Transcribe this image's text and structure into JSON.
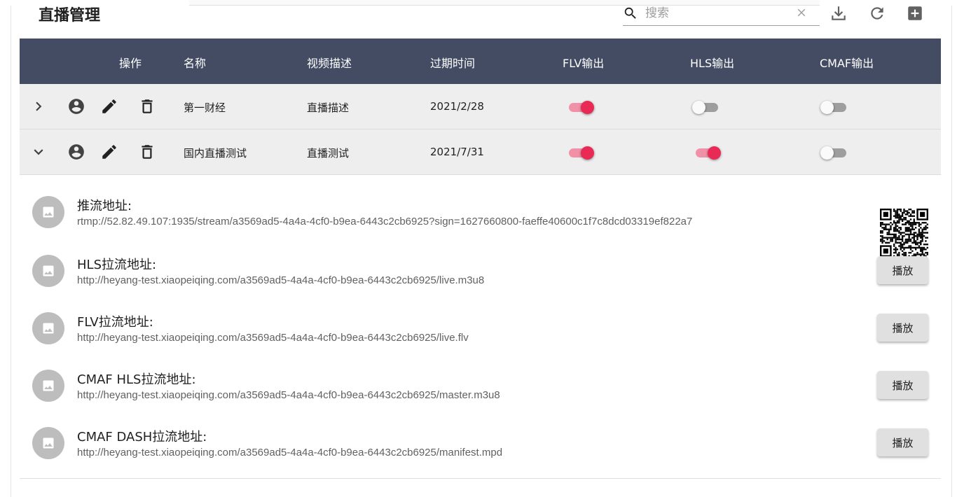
{
  "page": {
    "title": "直播管理"
  },
  "search": {
    "placeholder": "搜索"
  },
  "table": {
    "columns": [
      "操作",
      "名称",
      "视频描述",
      "过期时间",
      "FLV输出",
      "HLS输出",
      "CMAF输出"
    ],
    "rows": [
      {
        "name": "第一财经",
        "description": "直播描述",
        "expire": "2021/2/28",
        "flv": true,
        "hls": false,
        "cmaf": false,
        "expanded": false
      },
      {
        "name": "国内直播测试",
        "description": "直播测试",
        "expire": "2021/7/31",
        "flv": true,
        "hls": true,
        "cmaf": false,
        "expanded": true
      }
    ]
  },
  "details": {
    "push": {
      "label": "推流地址:",
      "url": "rtmp://52.82.49.107:1935/stream/a3569ad5-4a4a-4cf0-b9ea-6443c2cb6925?sign=1627660800-faeffe40600c1f7c8dcd03319ef822a7"
    },
    "pulls": [
      {
        "label": "HLS拉流地址:",
        "url": "http://heyang-test.xiaopeiqing.com/a3569ad5-4a4a-4cf0-b9ea-6443c2cb6925/live.m3u8",
        "button": "播放"
      },
      {
        "label": "FLV拉流地址:",
        "url": "http://heyang-test.xiaopeiqing.com/a3569ad5-4a4a-4cf0-b9ea-6443c2cb6925/live.flv",
        "button": "播放"
      },
      {
        "label": "CMAF HLS拉流地址:",
        "url": "http://heyang-test.xiaopeiqing.com/a3569ad5-4a4a-4cf0-b9ea-6443c2cb6925/master.m3u8",
        "button": "播放"
      },
      {
        "label": "CMAF DASH拉流地址:",
        "url": "http://heyang-test.xiaopeiqing.com/a3569ad5-4a4a-4cf0-b9ea-6443c2cb6925/manifest.mpd",
        "button": "播放"
      }
    ]
  },
  "colors": {
    "header_bg": "#434c63",
    "accent": "#e92a55",
    "row_bg": "#eeeeee"
  },
  "icons": {
    "toolbar": [
      "search-icon",
      "clear-icon",
      "download-icon",
      "refresh-icon",
      "add-box-icon"
    ],
    "row_actions": [
      "chevron-right-icon",
      "chevron-down-icon",
      "account-circle-icon",
      "edit-icon",
      "delete-icon"
    ],
    "detail": [
      "image-icon",
      "qr-code-icon"
    ]
  }
}
